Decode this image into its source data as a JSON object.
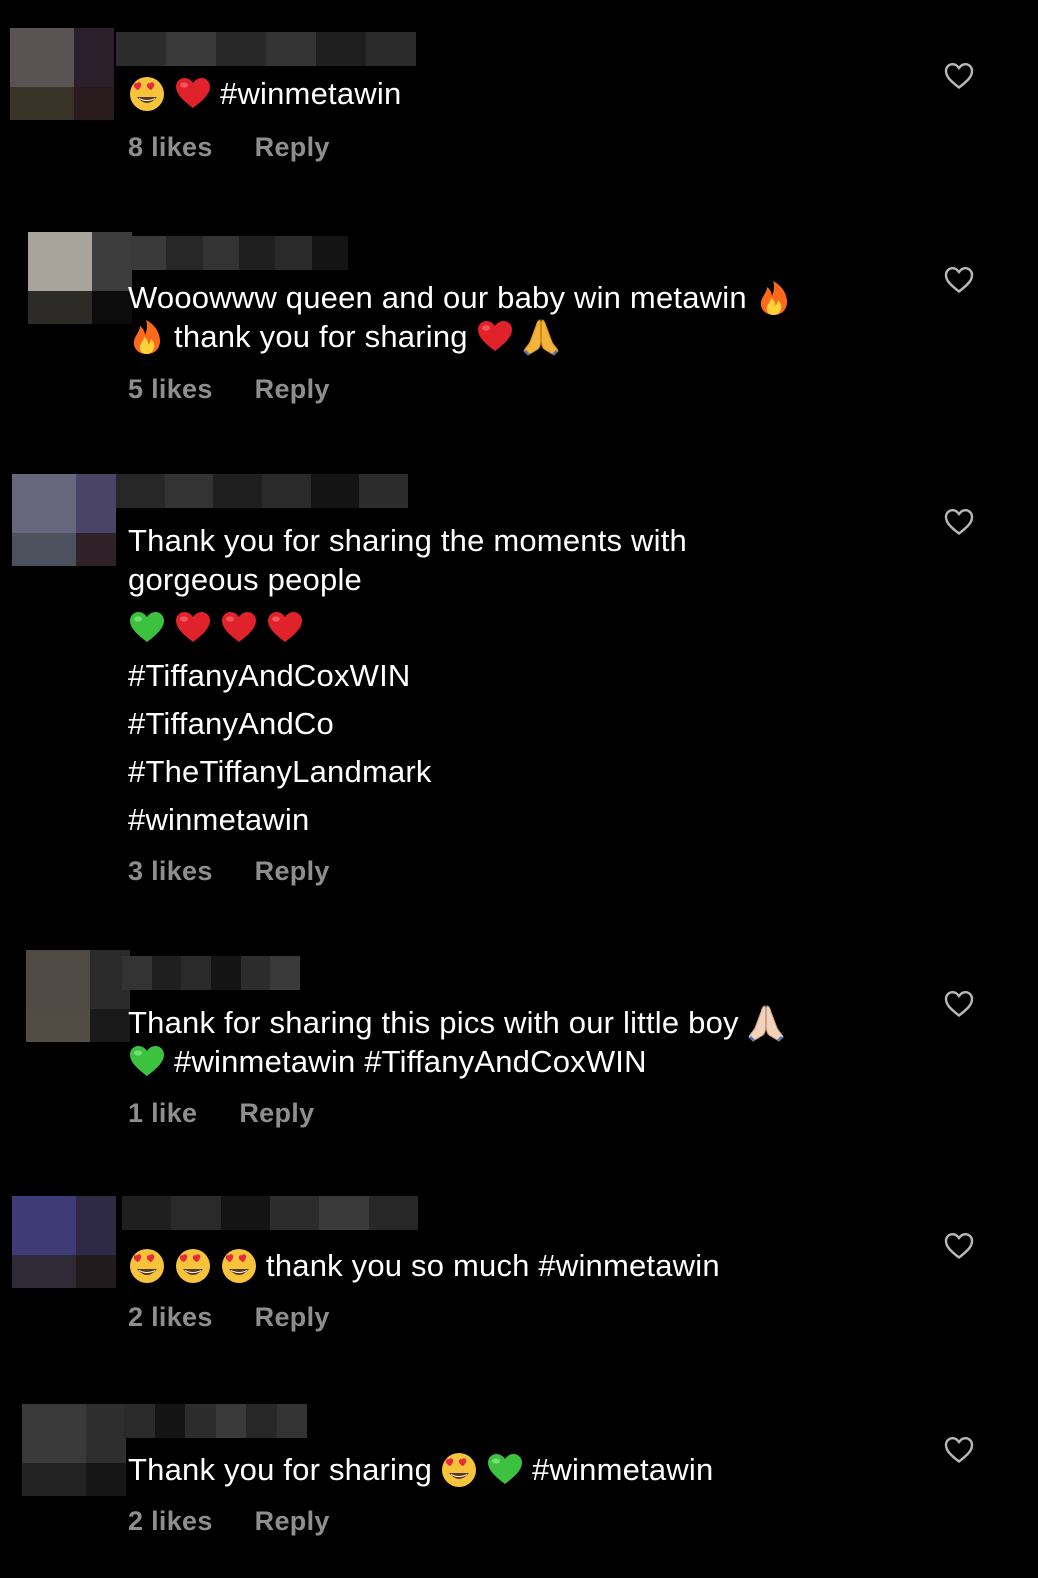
{
  "comments": [
    {
      "text_lines": [
        {
          "parts": [
            {
              "emoji": "heart-eyes"
            },
            {
              "emoji": "red-heart"
            },
            {
              "text": "#winmetawin"
            }
          ]
        }
      ],
      "likes": "8 likes",
      "reply": "Reply"
    },
    {
      "text_lines": [
        {
          "parts": [
            {
              "text": "Wooowww queen and our baby win metawin"
            },
            {
              "emoji": "fire"
            }
          ]
        },
        {
          "parts": [
            {
              "emoji": "fire"
            },
            {
              "text": "thank you for sharing"
            },
            {
              "emoji": "red-heart"
            },
            {
              "emoji": "folded-hands"
            }
          ]
        }
      ],
      "likes": "5 likes",
      "reply": "Reply"
    },
    {
      "text_lines": [
        {
          "parts": [
            {
              "text": "Thank you for sharing the moments with"
            }
          ]
        },
        {
          "parts": [
            {
              "text": "gorgeous people"
            }
          ]
        },
        {
          "parts": [
            {
              "emoji": "green-heart"
            },
            {
              "emoji": "red-heart"
            },
            {
              "emoji": "red-heart"
            },
            {
              "emoji": "red-heart"
            }
          ]
        },
        {
          "parts": [
            {
              "text": "#TiffanyAndCoxWIN"
            }
          ]
        },
        {
          "parts": [
            {
              "text": "#TiffanyAndCo"
            }
          ]
        },
        {
          "parts": [
            {
              "text": "#TheTiffanyLandmark"
            }
          ]
        },
        {
          "parts": [
            {
              "text": "#winmetawin"
            }
          ]
        }
      ],
      "likes": "3 likes",
      "reply": "Reply"
    },
    {
      "text_lines": [
        {
          "parts": [
            {
              "text": "Thank for sharing this pics with our little boy"
            },
            {
              "emoji": "folded-hands-light"
            }
          ]
        },
        {
          "parts": [
            {
              "emoji": "green-heart"
            },
            {
              "text": "#winmetawin #TiffanyAndCoxWIN"
            }
          ]
        }
      ],
      "likes": "1 like",
      "reply": "Reply"
    },
    {
      "text_lines": [
        {
          "parts": [
            {
              "emoji": "heart-eyes"
            },
            {
              "emoji": "heart-eyes"
            },
            {
              "emoji": "heart-eyes"
            },
            {
              "text": "thank you so much #winmetawin"
            }
          ]
        }
      ],
      "likes": "2 likes",
      "reply": "Reply"
    },
    {
      "text_lines": [
        {
          "parts": [
            {
              "text": "Thank you for sharing"
            },
            {
              "emoji": "heart-eyes"
            },
            {
              "emoji": "green-heart"
            },
            {
              "text": "#winmetawin"
            }
          ]
        }
      ],
      "likes": "2 likes",
      "reply": "Reply"
    }
  ],
  "icons": {
    "like": "heart-outline-icon"
  },
  "colors": {
    "background": "#000000",
    "text": "#ffffff",
    "meta": "#8e8e8e"
  }
}
